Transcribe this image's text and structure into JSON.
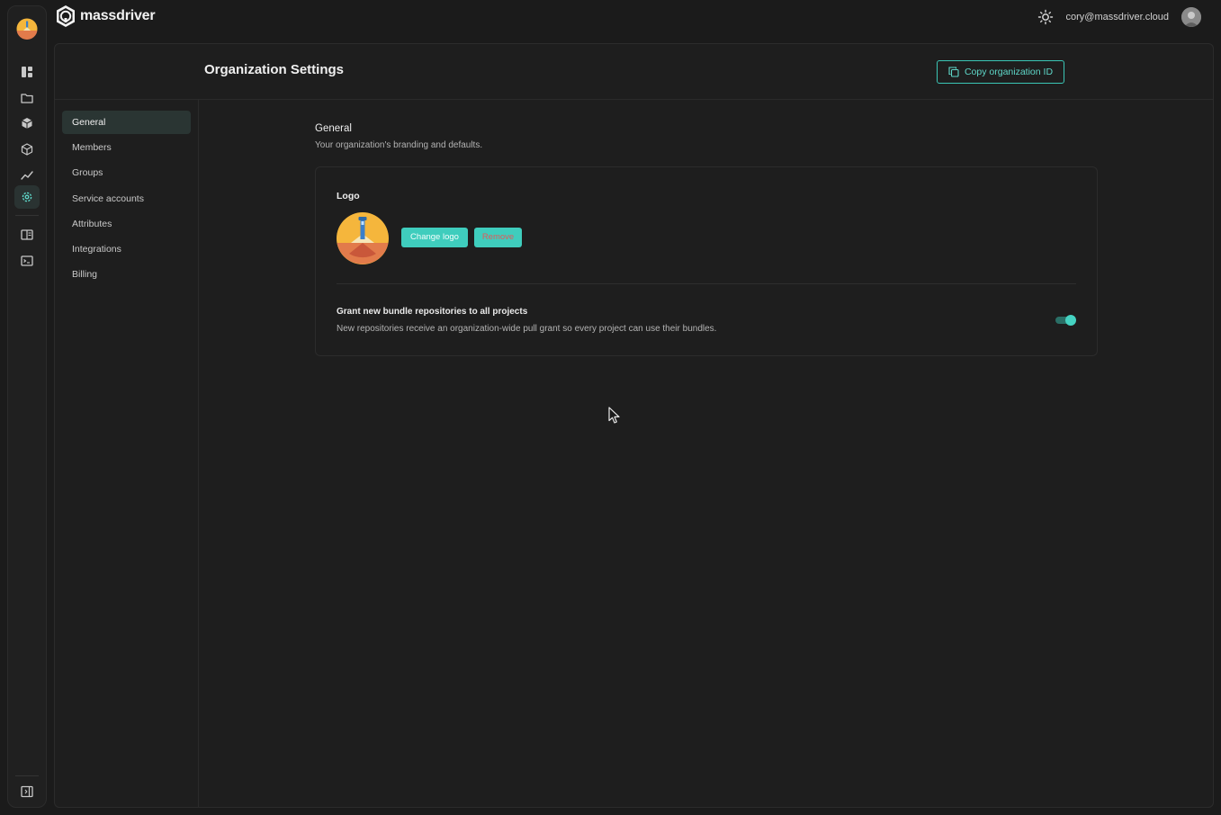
{
  "app": {
    "brand_name": "massdriver",
    "user_email": "cory@massdriver.cloud"
  },
  "rail": {
    "items": [
      {
        "icon": "dashboard-icon"
      },
      {
        "icon": "folder-icon"
      },
      {
        "icon": "bundles-icon"
      },
      {
        "icon": "package-icon"
      },
      {
        "icon": "chart-line-icon"
      },
      {
        "icon": "gear-icon",
        "active": true
      },
      {
        "icon": "docs-icon"
      },
      {
        "icon": "terminal-icon"
      }
    ],
    "collapse_icon": "sidebar-toggle-icon"
  },
  "header": {
    "title": "Organization Settings",
    "copy_button": "Copy organization ID"
  },
  "nav": {
    "items": [
      {
        "label": "General",
        "active": true
      },
      {
        "label": "Members"
      },
      {
        "label": "Groups"
      },
      {
        "label": "Service accounts"
      },
      {
        "label": "Attributes"
      },
      {
        "label": "Integrations"
      },
      {
        "label": "Billing"
      }
    ]
  },
  "section": {
    "title": "General",
    "description": "Your organization's branding and defaults."
  },
  "card": {
    "logo_label": "Logo",
    "change_logo": "Change logo",
    "remove": "Remove",
    "grant_title": "Grant new bundle repositories to all projects",
    "grant_description": "New repositories receive an organization-wide pull grant so every project can use their bundles.",
    "grant_enabled": true
  },
  "colors": {
    "accent": "#3fcdbd",
    "danger": "#e2595a",
    "background": "#1b1b1b"
  }
}
